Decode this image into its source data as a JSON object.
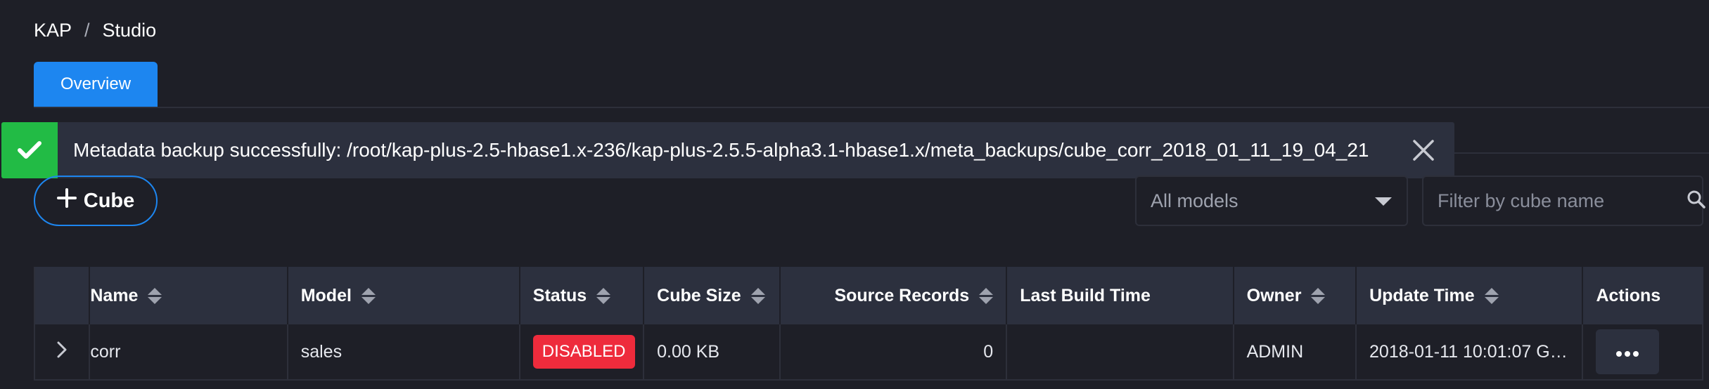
{
  "breadcrumb": {
    "root": "KAP",
    "separator": "/",
    "current": "Studio"
  },
  "tabs": [
    {
      "label": "Overview",
      "active": true
    }
  ],
  "notification": {
    "message": "Metadata backup successfully: /root/kap-plus-2.5-hbase1.x-236/kap-plus-2.5.5-alpha3.1-hbase1.x/meta_backups/cube_corr_2018_01_11_19_04_21",
    "icon": "check-icon",
    "color": "#22bb45"
  },
  "toolbar": {
    "add_cube_label": "Cube",
    "model_select_value": "All models",
    "filter_placeholder": "Filter by cube name"
  },
  "table": {
    "headers": {
      "name": "Name",
      "model": "Model",
      "status": "Status",
      "cube_size": "Cube Size",
      "source_records": "Source Records",
      "last_build_time": "Last Build Time",
      "owner": "Owner",
      "update_time": "Update Time",
      "actions": "Actions"
    },
    "rows": [
      {
        "name": "corr",
        "model": "sales",
        "status": "DISABLED",
        "cube_size": "0.00 KB",
        "source_records": "0",
        "last_build_time": "",
        "owner": "ADMIN",
        "update_time": "2018-01-11 10:01:07 GM..."
      }
    ]
  },
  "colors": {
    "accent": "#1d86f0",
    "success": "#22bb45",
    "danger": "#ee2b3c",
    "background": "#1e1f27",
    "header_bg": "#2c303e"
  }
}
